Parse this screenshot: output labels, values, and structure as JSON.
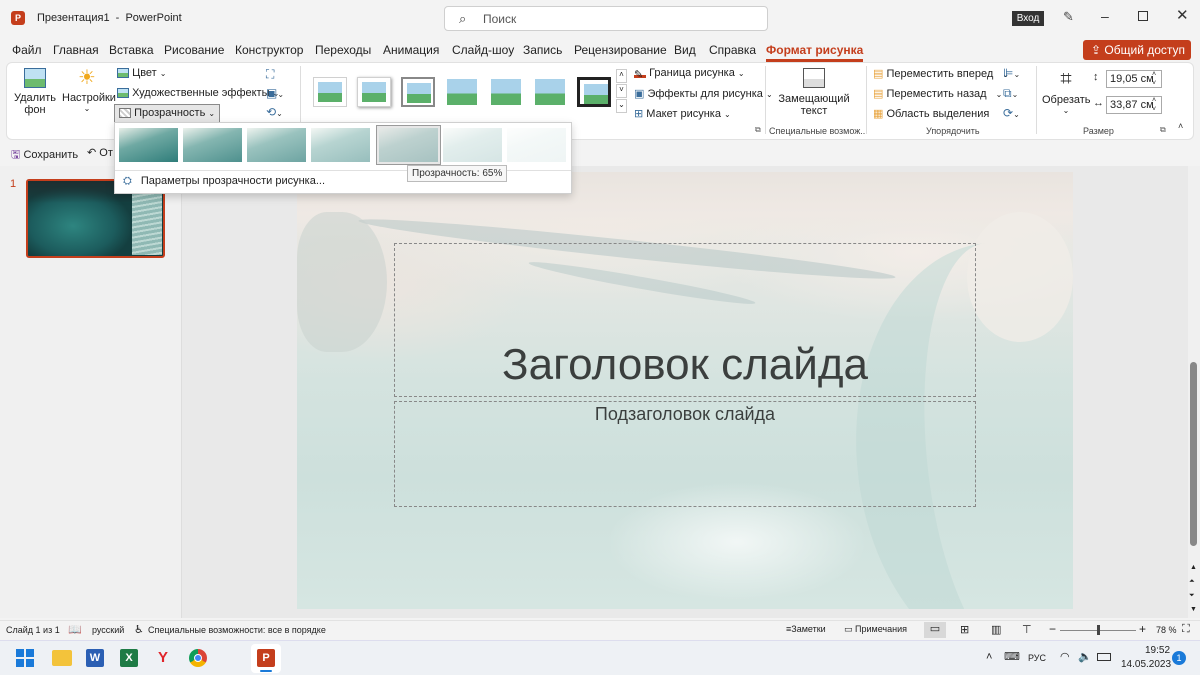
{
  "window": {
    "title": "Презентация1  -  PowerPoint",
    "search_placeholder": "Поиск",
    "signin_label": "Вход"
  },
  "menu": {
    "tabs": [
      "Файл",
      "Главная",
      "Вставка",
      "Рисование",
      "Конструктор",
      "Переходы",
      "Анимация",
      "Слайд-шоу",
      "Запись",
      "Рецензирование",
      "Вид",
      "Справка",
      "Формат рисунка"
    ],
    "share_label": "Общий доступ"
  },
  "ribbon": {
    "remove_bg": "Удалить фон",
    "remove_bg_l1": "Удалить",
    "remove_bg_l2": "фон",
    "corrections": "Настройки",
    "color": "Цвет",
    "artistic": "Художественные эффекты",
    "transparency": "Прозрачность",
    "picture_border": "Граница рисунка",
    "picture_effects": "Эффекты для рисунка",
    "picture_layout": "Макет рисунка",
    "alt_text_l1": "Замещающий",
    "alt_text_l2": "текст",
    "group_accessibility": "Специальные возмож...",
    "bring_forward": "Переместить вперед",
    "send_backward": "Переместить назад",
    "selection_pane": "Область выделения",
    "group_arrange": "Упорядочить",
    "crop": "Обрезать",
    "height": "19,05 см",
    "width": "33,87 см",
    "group_size": "Размер"
  },
  "qat": {
    "save": "Сохранить",
    "undo_partial": "От"
  },
  "dropdown": {
    "options_label": "Параметры прозрачности рисунка...",
    "levels_count": 7,
    "selected_index": 4,
    "tooltip": "Прозрачность: 65%"
  },
  "slide": {
    "number": "1",
    "title": "Заголовок слайда",
    "subtitle": "Подзаголовок слайда"
  },
  "status": {
    "slide_info": "Слайд 1 из 1",
    "language": "русский",
    "accessibility": "Специальные возможности: все в порядке",
    "notes": "Заметки",
    "comments": "Примечания",
    "zoom": "78 %",
    "zoom_fraction": 0.49
  },
  "taskbar": {
    "lang": "РУС",
    "time": "19:52",
    "date": "14.05.2023",
    "notifications": "1"
  },
  "colors": {
    "accent": "#c43e1c",
    "active_tab": "#c43e1c",
    "share_bg": "#c43e1c"
  }
}
